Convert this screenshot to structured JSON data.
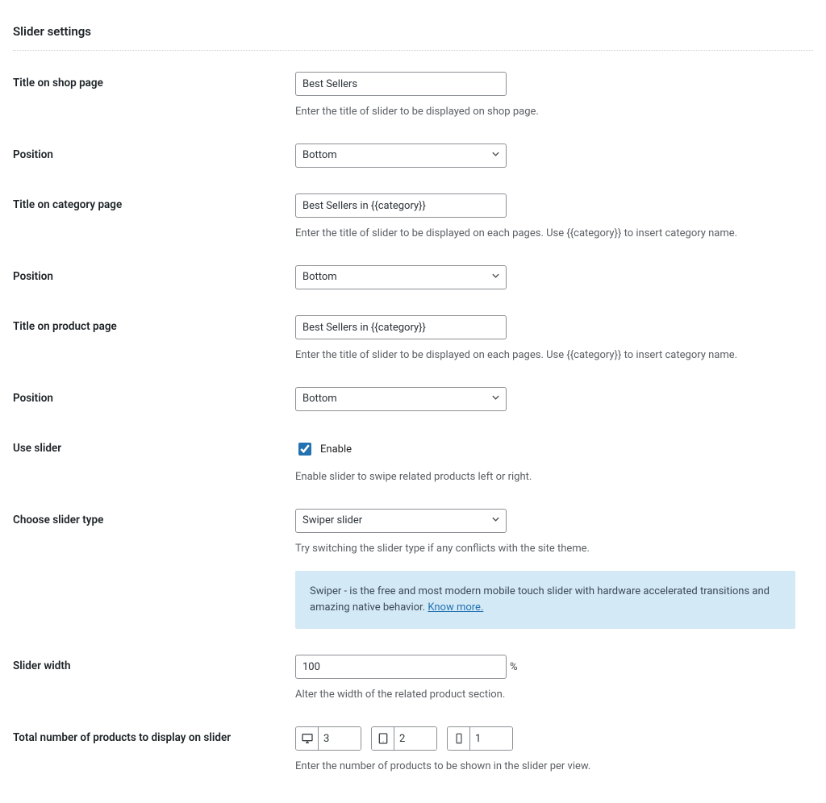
{
  "section_title": "Slider settings",
  "rows": {
    "title_shop": {
      "label": "Title on shop page",
      "value": "Best Sellers",
      "help": "Enter the title of slider to be displayed on shop page."
    },
    "position_shop": {
      "label": "Position",
      "value": "Bottom"
    },
    "title_category": {
      "label": "Title on category page",
      "value": "Best Sellers in {{category}}",
      "help": "Enter the title of slider to be displayed on each pages. Use {{category}} to insert category name."
    },
    "position_category": {
      "label": "Position",
      "value": "Bottom"
    },
    "title_product": {
      "label": "Title on product page",
      "value": "Best Sellers in {{category}}",
      "help": "Enter the title of slider to be displayed on each pages. Use {{category}} to insert category name."
    },
    "position_product": {
      "label": "Position",
      "value": "Bottom"
    },
    "use_slider": {
      "label": "Use slider",
      "enable_text": "Enable",
      "help": "Enable slider to swipe related products left or right."
    },
    "slider_type": {
      "label": "Choose slider type",
      "value": "Swiper slider",
      "help": "Try switching the slider type if any conflicts with the site theme.",
      "info_text": "Swiper - is the free and most modern mobile touch slider with hardware accelerated transitions and amazing native behavior. ",
      "info_link": "Know more."
    },
    "slider_width": {
      "label": "Slider width",
      "value": "100",
      "unit": "%",
      "help": "Alter the width of the related product section."
    },
    "per_view": {
      "label": "Total number of products to display on slider",
      "desktop": "3",
      "tablet": "2",
      "mobile": "1",
      "help": "Enter the number of products to be shown in the slider per view."
    }
  }
}
